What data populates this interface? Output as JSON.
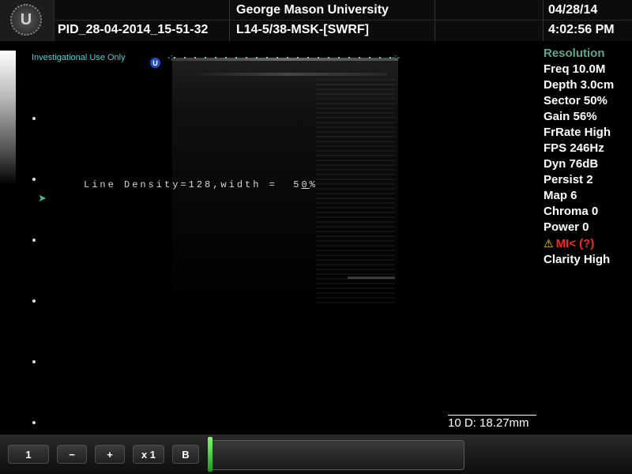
{
  "header": {
    "logo_letter": "U",
    "institution": "George Mason University",
    "patient_id": "PID_28-04-2014_15-51-32",
    "probe_preset": "L14-5/38-MSK-[SWRF]",
    "date": "04/28/14",
    "time": "4:02:56 PM"
  },
  "image_area": {
    "investigational_label": "Investigational Use Only",
    "badge_letter": "U",
    "line_density_prefix": "Line Density=128,width =  5",
    "line_density_underlined": "0",
    "line_density_suffix": "%",
    "focus_arrow": "➤",
    "cursor_left": "-:-",
    "cursor_right": "-:-"
  },
  "params": {
    "title": "Resolution",
    "freq": "Freq 10.0M",
    "depth": "Depth 3.0cm",
    "sector": "Sector 50%",
    "gain": "Gain 56%",
    "frrate": "FrRate High",
    "fps": "FPS 246Hz",
    "dyn": "Dyn 76dB",
    "persist": "Persist 2",
    "map": "Map 6",
    "chroma": "Chroma 0",
    "power": "Power 0",
    "mi_warning": "MI< (?)",
    "clarity": "Clarity High"
  },
  "measurement": {
    "text": "10 D: 18.27mm"
  },
  "toolbar": {
    "btn_one": "1",
    "btn_minus": "−",
    "btn_plus": "+",
    "btn_zoom": "x 1",
    "btn_b": "B",
    "slider_position": 0.0
  },
  "icons": {
    "warning": "warning-triangle-icon",
    "logo": "ultrasound-logo-icon"
  },
  "colors": {
    "accent_cyan": "#4fd1d1",
    "resolution_title": "#5fa78a",
    "warning_red": "#ff2222",
    "warning_yellow": "#ffd400",
    "slider_green": "#3fbf3f"
  }
}
